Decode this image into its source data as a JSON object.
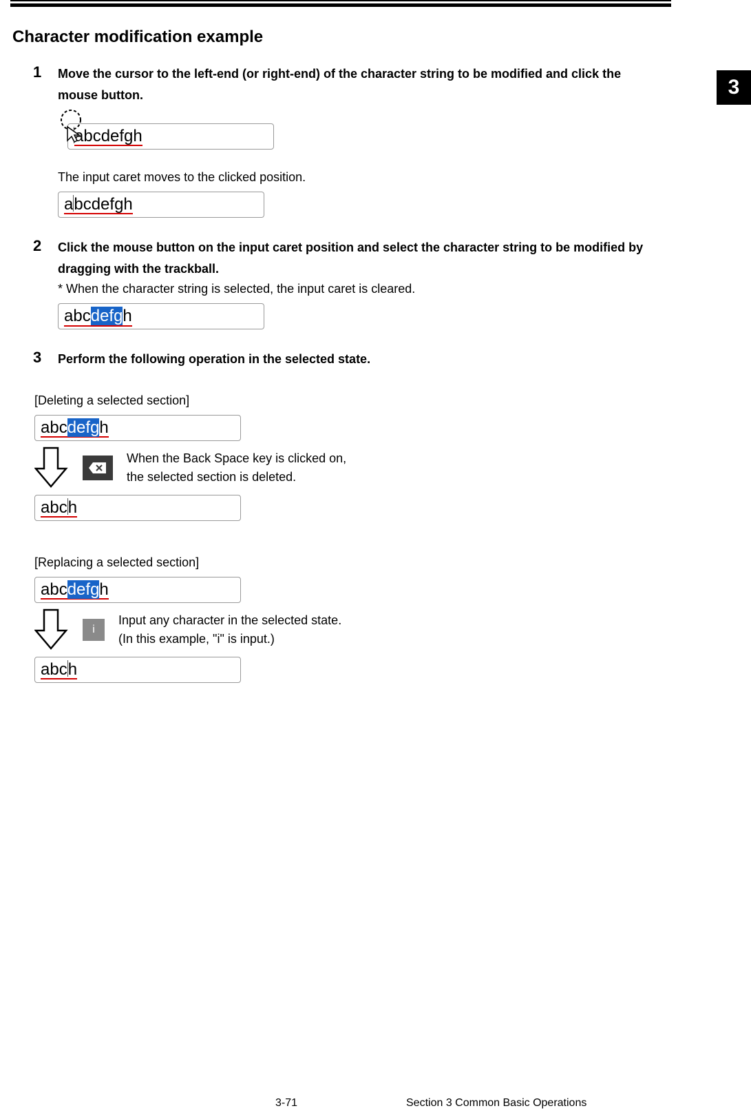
{
  "sideTab": "3",
  "title": "Character modification example",
  "steps": {
    "s1": {
      "num": "1",
      "text": "Move the cursor to the left-end (or right-end) of the character string to be modified and click the mouse button.",
      "box1_full": "abcdefgh",
      "caption": "The input caret moves to the clicked position.",
      "box2_full": "abcdefgh"
    },
    "s2": {
      "num": "2",
      "text": "Click the mouse button on the input caret position and select the character string to be modified by dragging with the trackball.",
      "note": "* When the character string is selected, the input caret is cleared.",
      "box_pre": "abc",
      "box_sel": "defg",
      "box_post": "h"
    },
    "s3": {
      "num": "3",
      "text": "Perform the following operation in the selected state."
    }
  },
  "delete": {
    "heading": "[Deleting a selected section]",
    "box_pre": "abc",
    "box_sel": "defg",
    "box_post": "h",
    "desc1": "When the Back Space key is clicked on,",
    "desc2": "the selected section is deleted.",
    "result_pre": "abc",
    "result_post": "h"
  },
  "replace": {
    "heading": "[Replacing a selected section]",
    "box_pre": "abc",
    "box_sel": "defg",
    "box_post": "h",
    "key": "i",
    "desc1": "Input any character in the selected state.",
    "desc2": "(In this example, \"i\" is input.)",
    "result_pre": "abc",
    "result_post": "h"
  },
  "footer": {
    "page": "3-71",
    "section": "Section 3    Common Basic Operations"
  }
}
